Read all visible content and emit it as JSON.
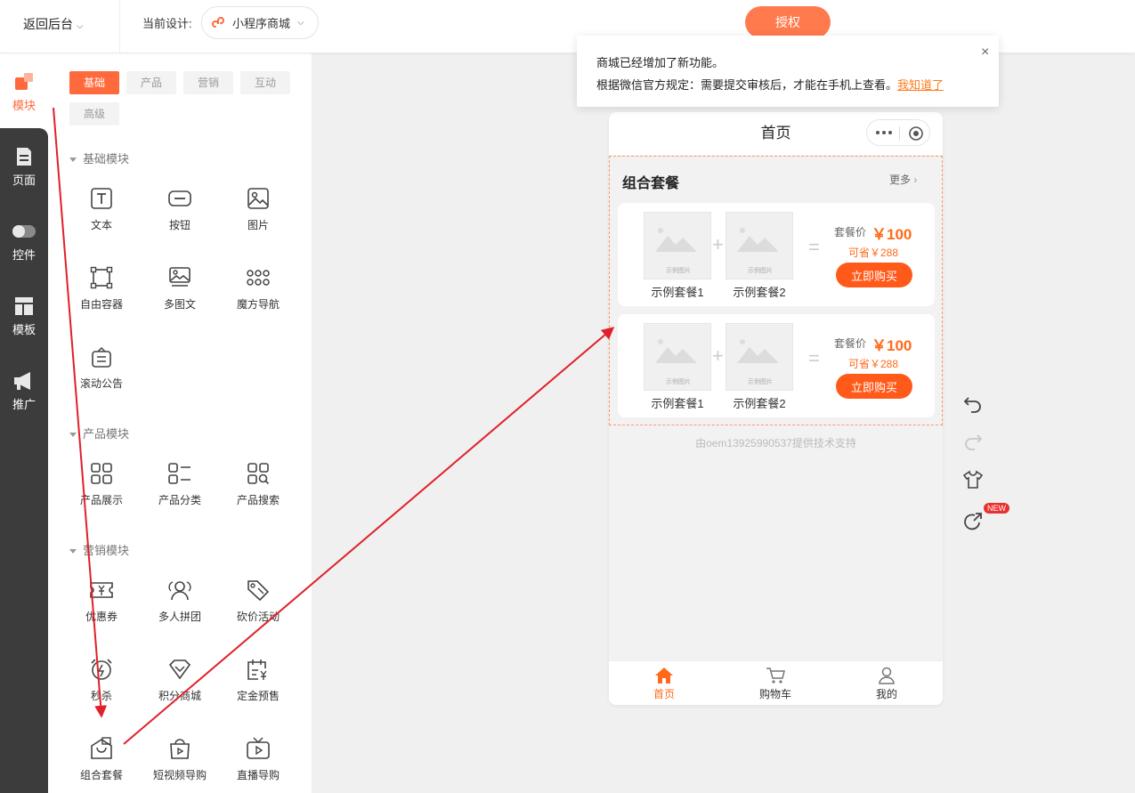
{
  "topbar": {
    "back_label": "返回后台",
    "current_design_label": "当前设计:",
    "design_name": "小程序商城",
    "auth_button": "授权"
  },
  "leftnav": {
    "items": [
      {
        "label": "模块",
        "icon": "module-icon",
        "active": true
      },
      {
        "label": "页面",
        "icon": "page-icon"
      },
      {
        "label": "控件",
        "icon": "toggle-icon"
      },
      {
        "label": "模板",
        "icon": "template-icon"
      },
      {
        "label": "推广",
        "icon": "megaphone-icon"
      }
    ]
  },
  "panel": {
    "tabs": [
      "基础",
      "产品",
      "营销",
      "互动",
      "高级"
    ],
    "sections": [
      {
        "title": "基础模块",
        "items": [
          "文本",
          "按钮",
          "图片",
          "自由容器",
          "多图文",
          "魔方导航",
          "滚动公告"
        ]
      },
      {
        "title": "产品模块",
        "items": [
          "产品展示",
          "产品分类",
          "产品搜索"
        ]
      },
      {
        "title": "营销模块",
        "items": [
          "优惠券",
          "多人拼团",
          "砍价活动",
          "秒杀",
          "积分商城",
          "定金预售",
          "组合套餐",
          "短视频导购",
          "直播导购"
        ]
      }
    ]
  },
  "notice": {
    "line1": "商城已经增加了新功能。",
    "line2": "根据微信官方规定：需要提交审核后，才能在手机上查看。",
    "link": "我知道了",
    "close": "×"
  },
  "phone": {
    "title": "首页",
    "combo": {
      "title": "组合套餐",
      "more": "更多",
      "placeholder": "示例图片",
      "cards": [
        {
          "item1": "示例套餐1",
          "item2": "示例套餐2",
          "price_label": "套餐价",
          "price": "￥100",
          "save": "可省￥288",
          "buy": "立即购买"
        },
        {
          "item1": "示例套餐1",
          "item2": "示例套餐2",
          "price_label": "套餐价",
          "price": "￥100",
          "save": "可省￥288",
          "buy": "立即购买"
        }
      ]
    },
    "footer_note": "由oem13925990537提供技术支持",
    "tabbar": [
      {
        "label": "首页",
        "icon": "home-icon",
        "active": true
      },
      {
        "label": "购物车",
        "icon": "cart-icon"
      },
      {
        "label": "我的",
        "icon": "user-icon"
      }
    ]
  },
  "tools": {
    "new_badge": "NEW"
  },
  "colors": {
    "accent": "#ff6a3c",
    "price": "#ff6a1a",
    "nav_dark": "#3c3c3c",
    "arrow": "#e0202a"
  }
}
